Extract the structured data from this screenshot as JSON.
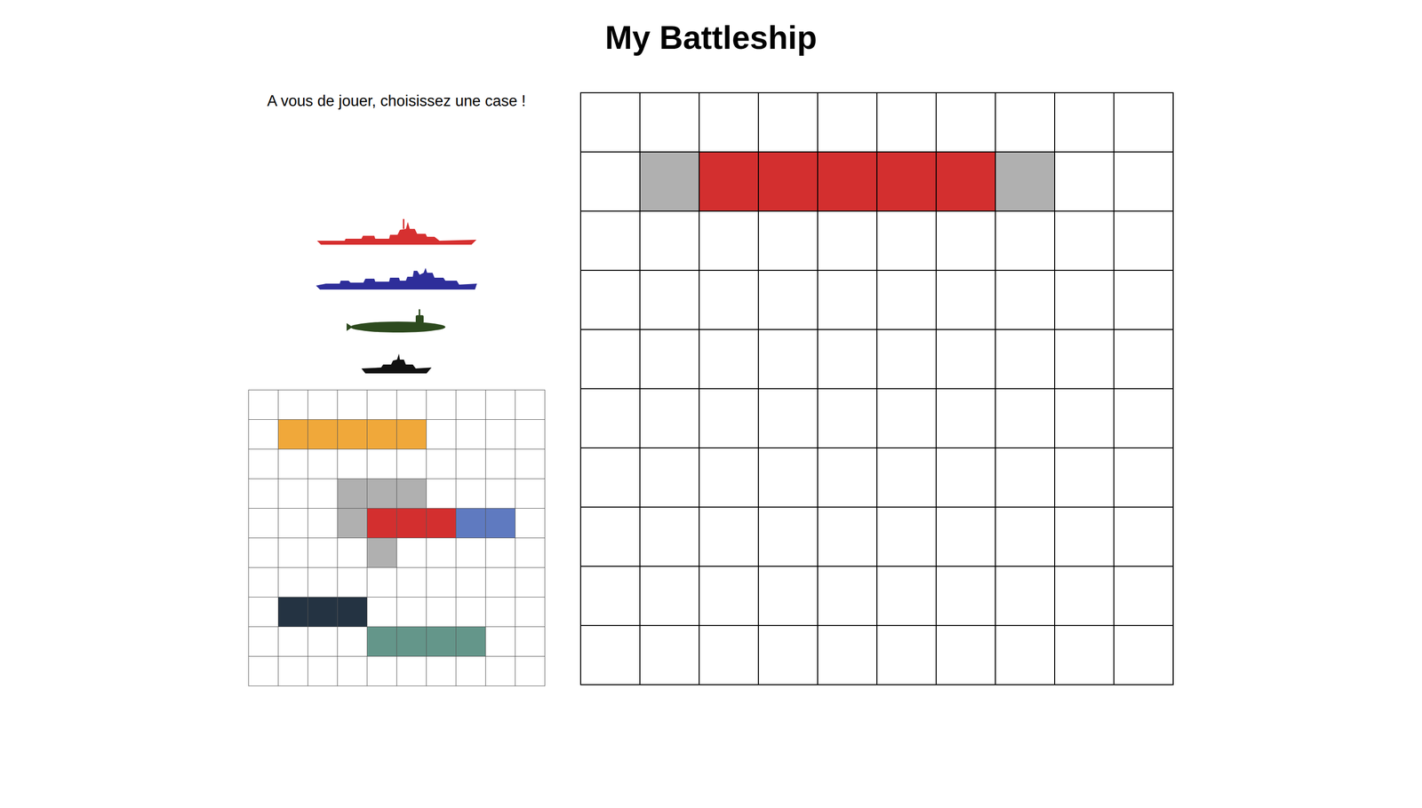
{
  "title": "My Battleship",
  "status": "A vous de jouer, choisissez une case !",
  "fleet": [
    {
      "kind": "battleship",
      "color": "#d63030"
    },
    {
      "kind": "cruiser",
      "color": "#2e2e9a"
    },
    {
      "kind": "submarine",
      "color": "#2d4a1e"
    },
    {
      "kind": "patrol",
      "color": "#111111"
    }
  ],
  "cell_marks": {
    ".": {
      "state": "empty",
      "color": "#ffffff"
    },
    "O": {
      "state": "ship",
      "color": "#f0a83a"
    },
    "B": {
      "state": "ship",
      "color": "#5f7ac0"
    },
    "N": {
      "state": "ship",
      "color": "#243342"
    },
    "T": {
      "state": "ship",
      "color": "#64968a"
    },
    "H": {
      "state": "hit",
      "color": "#d32f2f"
    },
    "M": {
      "state": "miss",
      "color": "#b0b0b0"
    }
  },
  "player_board": {
    "rows": [
      "..........",
      ".OOOOO....",
      "..........",
      "...MMM....",
      "...MHHHBB.",
      "....M.....",
      "..........",
      ".NNN......",
      "....TTTT..",
      ".........."
    ]
  },
  "opponent_board": {
    "rows": [
      "..........",
      ".MHHHHHM..",
      "..........",
      "..........",
      "..........",
      "..........",
      "..........",
      "..........",
      "..........",
      ".........."
    ]
  }
}
